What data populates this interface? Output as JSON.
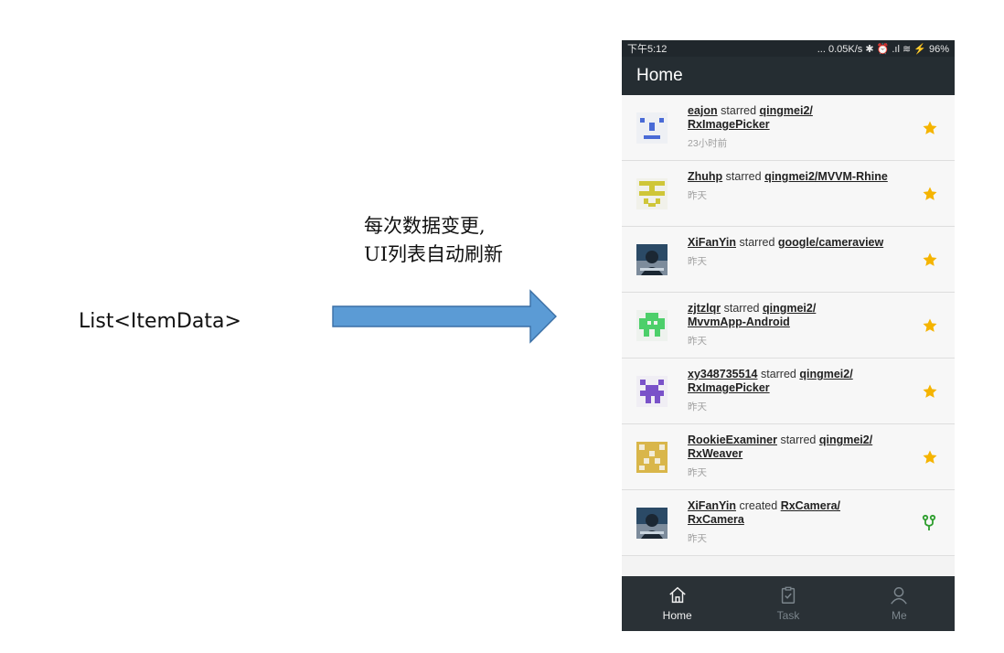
{
  "diagram": {
    "list_label": "List<ItemData>",
    "caption_line1": "每次数据变更,",
    "caption_line2": "UI列表自动刷新"
  },
  "statusbar": {
    "time": "下午5:12",
    "indicators": "... 0.05K/s ✱ ⏰ .ıl ≋ ⚡ 96%"
  },
  "appbar": {
    "title": "Home"
  },
  "feed": [
    {
      "user": "eajon",
      "action": "starred",
      "repo_line1": "qingmei2/",
      "repo_line2": "RxImagePicker",
      "time": "23小时前",
      "avatar_icon": "identicon-blue",
      "action_icon": "star-icon"
    },
    {
      "user": "Zhuhp",
      "action": "starred",
      "repo_line1": "qingmei2/MVVM-Rhine",
      "repo_line2": "",
      "time": "昨天",
      "avatar_icon": "identicon-yellow",
      "action_icon": "star-icon"
    },
    {
      "user": "XiFanYin",
      "action": "starred",
      "repo_line1": "google/cameraview",
      "repo_line2": "",
      "time": "昨天",
      "avatar_icon": "photo-avatar",
      "action_icon": "star-icon"
    },
    {
      "user": "zjtzlqr",
      "action": "starred",
      "repo_line1": "qingmei2/",
      "repo_line2": "MvvmApp-Android",
      "time": "昨天",
      "avatar_icon": "identicon-green",
      "action_icon": "star-icon"
    },
    {
      "user": "xy348735514",
      "action": "starred",
      "repo_line1": "qingmei2/",
      "repo_line2": "RxImagePicker",
      "time": "昨天",
      "avatar_icon": "identicon-purple",
      "action_icon": "star-icon"
    },
    {
      "user": "RookieExaminer",
      "action": "starred",
      "repo_line1": "qingmei2/",
      "repo_line2": "RxWeaver",
      "time": "昨天",
      "avatar_icon": "identicon-mustard",
      "action_icon": "star-icon"
    },
    {
      "user": "XiFanYin",
      "action": "created",
      "repo_line1": "RxCamera/",
      "repo_line2": "RxCamera",
      "time": "昨天",
      "avatar_icon": "photo-avatar",
      "action_icon": "fork-icon"
    }
  ],
  "bottomnav": [
    {
      "label": "Home",
      "icon": "home-icon",
      "active": true
    },
    {
      "label": "Task",
      "icon": "task-icon",
      "active": false
    },
    {
      "label": "Me",
      "icon": "user-icon",
      "active": false
    }
  ],
  "colors": {
    "appbar": "#252d32",
    "star": "#f5b400",
    "fork": "#2e9e2e",
    "nav": "#2a3136"
  }
}
